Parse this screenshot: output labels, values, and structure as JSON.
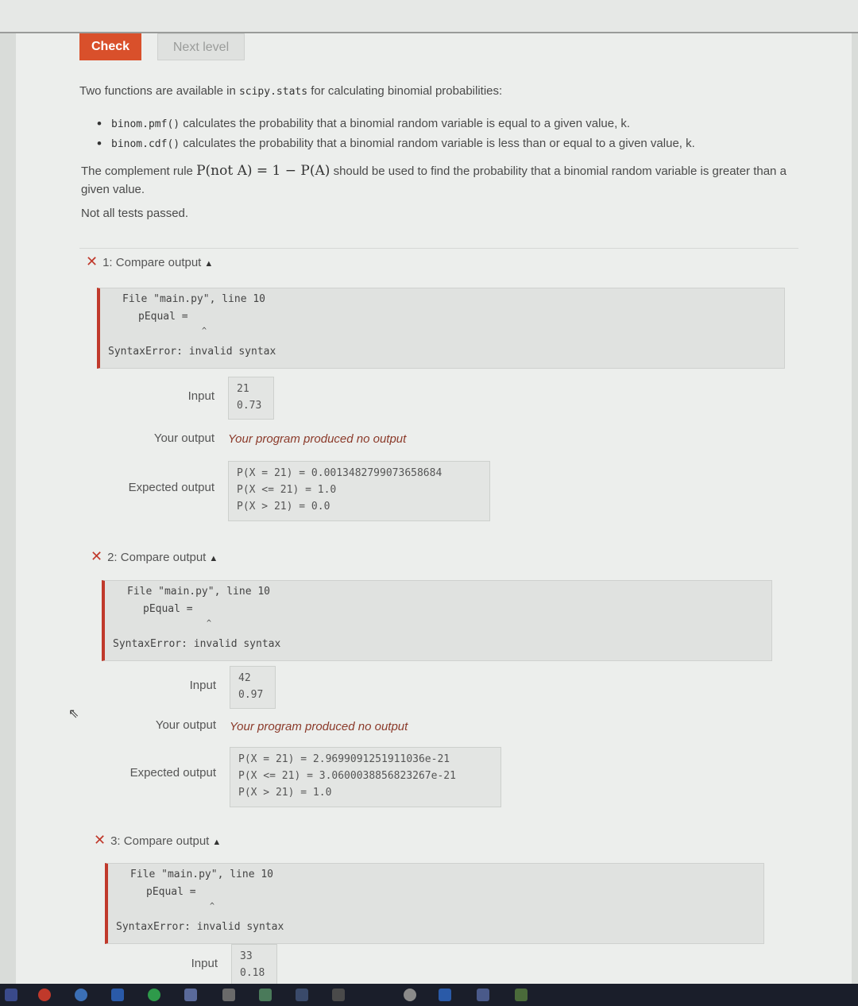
{
  "buttons": {
    "check": "Check",
    "next_level": "Next level"
  },
  "intro": {
    "before": "Two functions are available in",
    "module": "scipy.stats",
    "after": "for calculating binomial probabilities:"
  },
  "bullets": [
    {
      "code": "binom.pmf()",
      "text": "calculates the probability that a binomial random variable is equal to a given value, k."
    },
    {
      "code": "binom.cdf()",
      "text": "calculates the probability that a binomial random variable is less than or equal to a given value, k."
    }
  ],
  "complement": {
    "before": "The complement rule",
    "formula": "P(not A) = 1 − P(A)",
    "after": "should be used to find the probability that a binomial random variable is greater than a given value."
  },
  "status": "Not all tests passed.",
  "labels": {
    "input": "Input",
    "your_output": "Your output",
    "expected_output": "Expected output",
    "no_output": "Your program produced no output"
  },
  "tests": [
    {
      "title": "1: Compare output",
      "error": [
        "File \"main.py\", line 10",
        "pEqual =",
        "^",
        "SyntaxError: invalid syntax"
      ],
      "input": [
        "21",
        "0.73"
      ],
      "expected": [
        "P(X = 21) = 0.0013482799073658684",
        "P(X <= 21) = 1.0",
        "P(X > 21) = 0.0"
      ]
    },
    {
      "title": "2: Compare output",
      "error": [
        "File \"main.py\", line 10",
        "pEqual =",
        "^",
        "SyntaxError: invalid syntax"
      ],
      "input": [
        "42",
        "0.97"
      ],
      "expected": [
        "P(X = 21) = 2.9699091251911036e-21",
        "P(X <= 21) = 3.0600038856823267e-21",
        "P(X > 21) = 1.0"
      ]
    },
    {
      "title": "3: Compare output",
      "error": [
        "File \"main.py\", line 10",
        "pEqual =",
        "^",
        "SyntaxError: invalid syntax"
      ],
      "input": [
        "33",
        "0.18"
      ]
    }
  ]
}
